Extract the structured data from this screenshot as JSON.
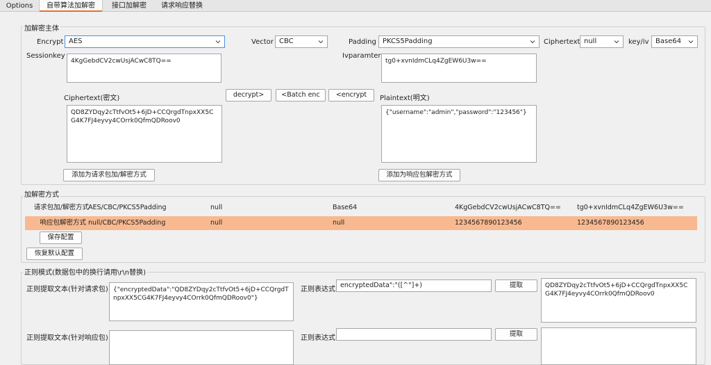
{
  "tabs": [
    {
      "label": "Options"
    },
    {
      "label": "自带算法加解密"
    },
    {
      "label": "接口加解密"
    },
    {
      "label": "请求响应替换"
    }
  ],
  "crypto": {
    "legend": "加解密主体",
    "encrypt_label": "Encrypt",
    "encrypt_value": "AES",
    "vector_label": "Vector",
    "vector_value": "CBC",
    "padding_label": "Padding",
    "padding_value": "PKCS5Padding",
    "ciphertext_label": "Ciphertext",
    "ciphertext_value": "null",
    "keyiv_label": "key/iv",
    "keyiv_value": "Base64",
    "sessionkey_label": "Sessionkey",
    "sessionkey_value": "4KgGebdCV2cwUsjACwC8TQ==",
    "ivparam_label": "Ivparamter",
    "ivparam_value": "tg0+xvnIdmCLq4ZgEW6U3w==",
    "cipher_area_label": "Ciphertext(密文)",
    "cipher_area_value": "QD8ZYDqy2cTtfvOt5+6jD+CCQrgdTnpxXX5CG4K7FJ4eyvy4COrrk0QfmQDRoov0",
    "plain_area_label": "Plaintext(明文)",
    "plain_area_value": "{\"username\":\"admin\",\"password\":\"123456\"}",
    "decrypt_button": "decrypt>",
    "batch_enc_button": "<Batch enc",
    "encrypt_button": "<encrypt",
    "add_request_button": "添加为请求包加/解密方式",
    "add_response_button": "添加为响应包解密方式"
  },
  "methods": {
    "legend": "加解密方式",
    "rows": [
      {
        "name": "请求包加/解密方式",
        "algo": "AES/CBC/PKCS5Padding",
        "cipher": "null",
        "keyiv": "Base64",
        "key": "4KgGebdCV2cwUsjACwC8TQ==",
        "iv": "tg0+xvnIdmCLq4ZgEW6U3w=="
      },
      {
        "name": "响应包解密方式",
        "algo": "null/CBC/PKCS5Padding",
        "cipher": "null",
        "keyiv": "null",
        "key": "1234567890123456",
        "iv": "1234567890123456"
      }
    ],
    "save_button": "保存配置",
    "restore_button": "恢复默认配置"
  },
  "regex": {
    "legend": "正则模式(数据包中的换行请用\\r\\n替换)",
    "req_text_label": "正则提取文本(针对请求包)",
    "req_text_value": "{\"encryptedData\":\"QD8ZYDqy2cTtfvOt5+6jD+CCQrgdTnpxXX5CG4K7FJ4eyvy4COrrk0QfmQDRoov0\"}",
    "req_expr_label": "正则表达式",
    "req_expr_value": "encryptedData\":\"([^\"]+)",
    "req_extract_button": "提取",
    "req_result_value": "QD8ZYDqy2cTtfvOt5+6jD+CCQrgdTnpxXX5CG4K7FJ4eyvy4COrrk0QfmQDRoov0",
    "resp_text_label": "正则提取文本(针对响应包)",
    "resp_text_value": "",
    "resp_expr_label": "正则表达式",
    "resp_expr_value": "",
    "resp_extract_button": "提取",
    "resp_result_value": ""
  },
  "colors": {
    "accent_tab": "#e8702a",
    "selected_row": "#f8b990",
    "focus_border": "#4a90e2"
  }
}
